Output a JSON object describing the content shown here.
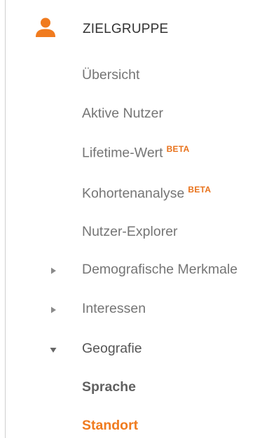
{
  "colors": {
    "accent": "#f07b1f",
    "beta": "#e8711a",
    "text_muted": "#757575",
    "text_dark": "#333333"
  },
  "section": {
    "icon": "person-icon",
    "label": "ZIELGRUPPE"
  },
  "items": [
    {
      "label": "Übersicht"
    },
    {
      "label": "Aktive Nutzer"
    },
    {
      "label": "Lifetime-Wert",
      "badge": "BETA"
    },
    {
      "label": "Kohortenanalyse",
      "badge": "BETA"
    },
    {
      "label": "Nutzer-Explorer"
    },
    {
      "label": "Demografische Merkmale",
      "icon": "caret-right-icon"
    },
    {
      "label": "Interessen",
      "icon": "caret-right-icon"
    },
    {
      "label": "Geografie",
      "icon": "caret-down-icon"
    },
    {
      "label": "Sprache"
    },
    {
      "label": "Standort"
    }
  ]
}
